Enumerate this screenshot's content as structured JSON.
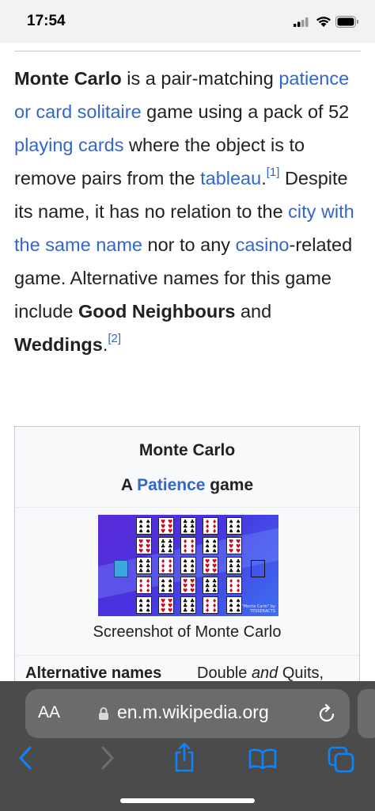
{
  "status_bar": {
    "time": "17:54"
  },
  "article": {
    "paragraph": [
      {
        "type": "bold",
        "text": "Monte Carlo"
      },
      {
        "type": "text",
        "text": " is a pair-matching "
      },
      {
        "type": "link",
        "text": "patience or card solitaire"
      },
      {
        "type": "text",
        "text": " game using a pack of 52 "
      },
      {
        "type": "link",
        "text": "playing cards"
      },
      {
        "type": "text",
        "text": " where the object is to remove pairs from the "
      },
      {
        "type": "link",
        "text": "tableau"
      },
      {
        "type": "text",
        "text": "."
      },
      {
        "type": "sup",
        "text": "[1]"
      },
      {
        "type": "text",
        "text": " Despite its name, it has no relation to the "
      },
      {
        "type": "link",
        "text": "city with the same name"
      },
      {
        "type": "text",
        "text": " nor to any "
      },
      {
        "type": "link",
        "text": "casino"
      },
      {
        "type": "text",
        "text": "-related game. Alternative names for this game include "
      },
      {
        "type": "bold",
        "text": "Good Neighbours"
      },
      {
        "type": "text",
        "text": " and "
      },
      {
        "type": "bold",
        "text": "Weddings"
      },
      {
        "type": "text",
        "text": "."
      },
      {
        "type": "sup",
        "text": "[2]"
      }
    ]
  },
  "infobox": {
    "title": "Monte Carlo",
    "subtitle_prefix": "A ",
    "subtitle_link": "Patience",
    "subtitle_suffix": " game",
    "image_caption": "Screenshot of Monte Carlo",
    "image_watermark_line1": "\"Monte Carlo\" by",
    "image_watermark_line2": "TESSERACTS",
    "rows": [
      {
        "label": "Alternative names",
        "value_prefix": "Double ",
        "value_italic": "and",
        "value_suffix": " Quits,"
      }
    ]
  },
  "browser": {
    "aa_label": "AA",
    "url": "en.m.wikipedia.org",
    "colors": {
      "bar": "#4b4b4b",
      "pill": "#6b6b6b",
      "accent": "#0a84ff"
    }
  },
  "icons": [
    "signal-icon",
    "wifi-icon",
    "battery-icon",
    "lock-icon",
    "reload-icon",
    "back-icon",
    "forward-icon",
    "share-icon",
    "bookmarks-icon",
    "tabs-icon"
  ]
}
